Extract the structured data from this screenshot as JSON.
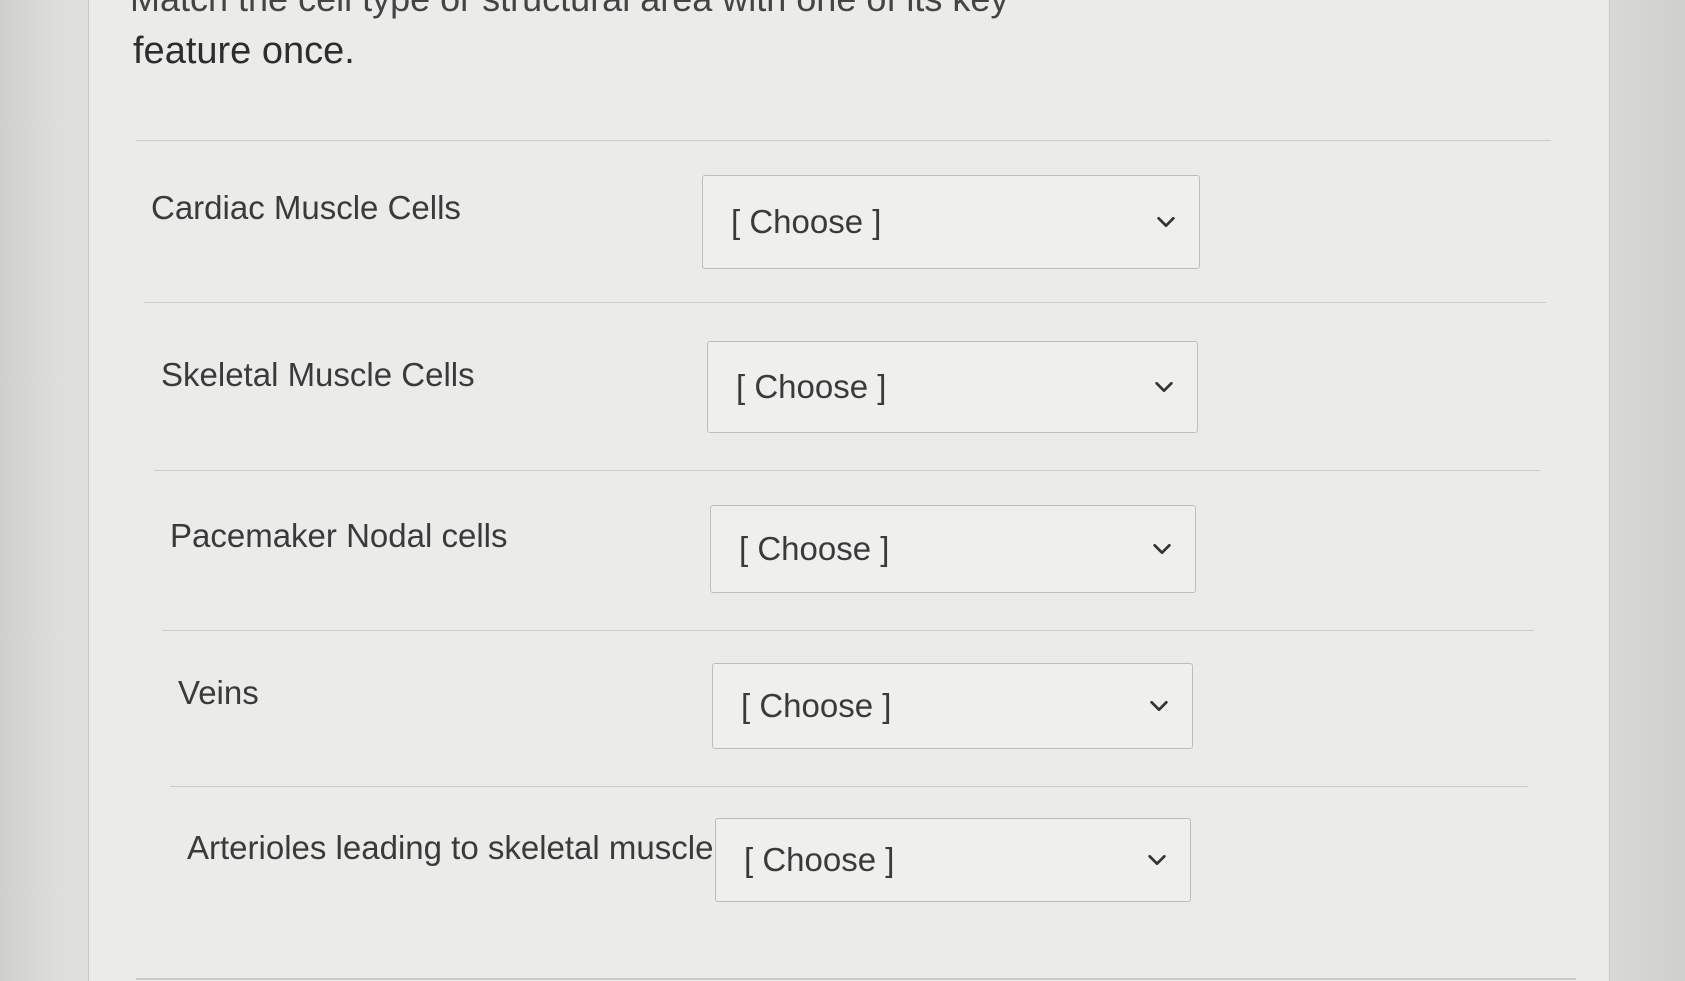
{
  "header": {
    "cut_off_text": "Match the cell type or structural area with one of its key",
    "instructions_tail": "feature once."
  },
  "rows": [
    {
      "label": "Cardiac Muscle Cells",
      "select_value": "[ Choose ]"
    },
    {
      "label": "Skeletal Muscle Cells",
      "select_value": "[ Choose ]"
    },
    {
      "label": "Pacemaker Nodal cells",
      "select_value": "[ Choose ]"
    },
    {
      "label": "Veins",
      "select_value": "[ Choose ]"
    },
    {
      "label": "Arterioles leading to skeletal muscle",
      "select_value": "[ Choose ]"
    }
  ],
  "icons": {
    "dropdown": "chevron-down-icon"
  },
  "colors": {
    "panel_background": "#ebebea",
    "text": "#3a3a3a",
    "border": "#bdbdbb"
  }
}
